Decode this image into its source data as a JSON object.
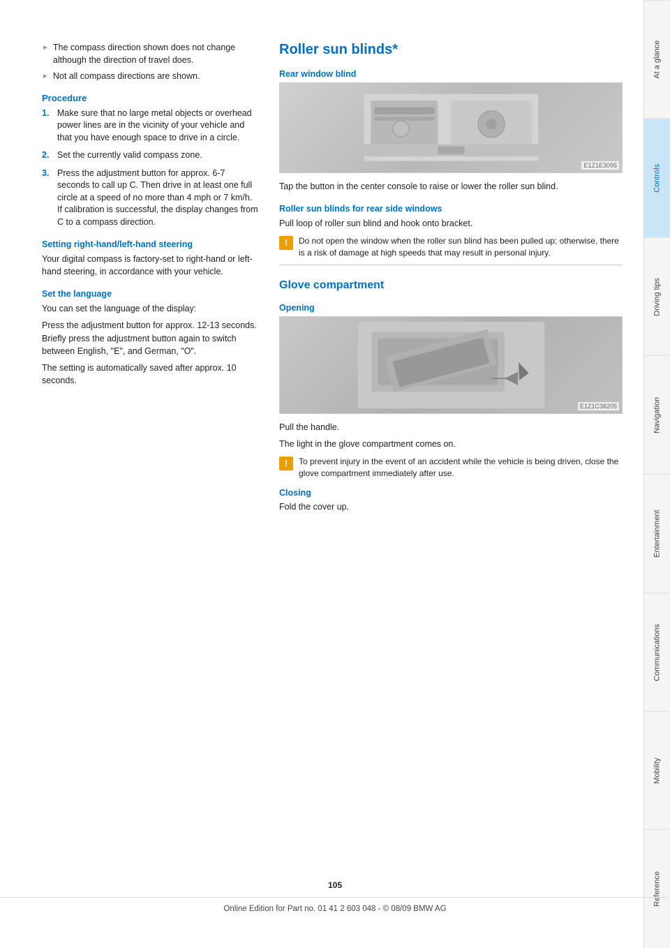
{
  "sidebar": {
    "tabs": [
      {
        "label": "At a glance",
        "active": false
      },
      {
        "label": "Controls",
        "active": true,
        "highlight": true
      },
      {
        "label": "Driving tips",
        "active": false
      },
      {
        "label": "Navigation",
        "active": false
      },
      {
        "label": "Entertainment",
        "active": false
      },
      {
        "label": "Communications",
        "active": false
      },
      {
        "label": "Mobility",
        "active": false
      },
      {
        "label": "Reference",
        "active": false
      }
    ]
  },
  "left_column": {
    "bullets": [
      "The compass direction shown does not change although the direction of travel does.",
      "Not all compass directions are shown."
    ],
    "procedure": {
      "heading": "Procedure",
      "steps": [
        "Make sure that no large metal objects or overhead power lines are in the vicinity of your vehicle and that you have enough space to drive in a circle.",
        "Set the currently valid compass zone.",
        "Press the adjustment button for approx. 6-7 seconds to call up C. Then drive in at least one full circle at a speed of no more than 4 mph or 7 km/h.\nIf calibration is successful, the display changes from C to a compass direction."
      ]
    },
    "setting_heading": "Setting right-hand/left-hand steering",
    "setting_text": "Your digital compass is factory-set to right-hand or left-hand steering, in accordance with your vehicle.",
    "language_heading": "Set the language",
    "language_text1": "You can set the language of the display:",
    "language_text2": "Press the adjustment button for approx. 12-13 seconds. Briefly press the adjustment button again to switch between English, \"E\", and German, \"O\".",
    "language_text3": "The setting is automatically saved after approx. 10 seconds."
  },
  "right_column": {
    "roller_title": "Roller sun blinds*",
    "rear_window_heading": "Rear window blind",
    "rear_window_text": "Tap the button in the center console to raise or lower the roller sun blind.",
    "roller_side_heading": "Roller sun blinds for rear side windows",
    "roller_side_text": "Pull loop of roller sun blind and hook onto bracket.",
    "roller_warning": "Do not open the window when the roller sun blind has been pulled up; otherwise, there is a risk of damage at high speeds that may result in personal injury.",
    "glove_title": "Glove compartment",
    "opening_heading": "Opening",
    "opening_text1": "Pull the handle.",
    "opening_text2": "The light in the glove compartment comes on.",
    "opening_warning": "To prevent injury in the event of an accident while the vehicle is being driven, close the glove compartment immediately after use.",
    "closing_heading": "Closing",
    "closing_text": "Fold the cover up.",
    "image1_id": "E1Z1E3095",
    "image2_id": "E1Z1C38205"
  },
  "footer": {
    "page_number": "105",
    "copyright_text": "Online Edition for Part no. 01 41 2 603 048 - © 08/09 BMW AG"
  }
}
